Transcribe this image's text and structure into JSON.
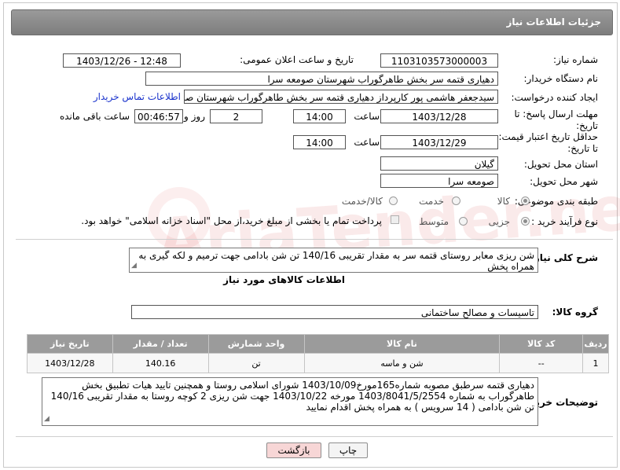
{
  "header": {
    "title": "جزئیات اطلاعات نیاز"
  },
  "fields": {
    "need_number_label": "شماره نیاز:",
    "need_number": "1103103573000003",
    "announce_label": "تاریخ و ساعت اعلان عمومی:",
    "announce_value": "1403/12/26 - 12:48",
    "buyer_org_label": "نام دستگاه خریدار:",
    "buyer_org": "دهیاری قتمه سر بخش طاهرگوراب شهرستان صومعه سرا",
    "creator_label": "ایجاد کننده درخواست:",
    "creator": "سیدجعفر هاشمی پور کارپرداز دهیاری قتمه سر بخش طاهرگوراب شهرستان صر",
    "contact_link": "اطلاعات تماس خریدار",
    "deadline_label": "مهلت ارسال پاسخ: تا تاریخ:",
    "deadline_date": "1403/12/28",
    "time_label": "ساعت",
    "deadline_time": "14:00",
    "days_value": "2",
    "days_label": "روز و",
    "remaining_time": "00:46:57",
    "remaining_label": "ساعت باقی مانده",
    "validity_label": "حداقل تاریخ اعتبار قیمت: تا تاریخ:",
    "validity_date": "1403/12/29",
    "validity_time": "14:00",
    "province_label": "استان محل تحویل:",
    "province": "گیلان",
    "city_label": "شهر محل تحویل:",
    "city": "صومعه سرا",
    "category_label": "طبقه بندی موضوعی:",
    "category_options": [
      "کالا",
      "خدمت",
      "کالا/خدمت"
    ],
    "purchase_label": "نوع فرآیند خرید :",
    "purchase_options": [
      "جزیی",
      "متوسط"
    ],
    "payment_note": "پرداخت تمام یا بخشی از مبلغ خرید،از محل \"اسناد خزانه اسلامی\" خواهد بود.",
    "summary_label": "شرح کلی نیاز:",
    "summary": "شن ریزی معابر روستای قتمه سر به مقدار تقریبی 140/16 تن شن بادامی جهت ترمیم و لکه گیری به همراه پخش",
    "goods_info_title": "اطلاعات کالاهای مورد نیاز",
    "goods_group_label": "گروه کالا:",
    "goods_group": "تاسیسات و مصالح ساختمانی"
  },
  "table": {
    "headers": [
      "ردیف",
      "کد کالا",
      "نام کالا",
      "واحد شمارش",
      "تعداد / مقدار",
      "تاریخ نیاز"
    ],
    "rows": [
      [
        "1",
        "--",
        "شن و ماسه",
        "تن",
        "140.16",
        "1403/12/28"
      ]
    ]
  },
  "buyer_notes": {
    "label": "توضیحات خریدار:",
    "text": "دهیاری قتمه سرطبق مصوبه شماره165مورخ1403/10/09 شورای اسلامی روستا و همچنین تایید هیات تطبیق بخش طاهرگوراب به شماره 1403/8041/5/2554 مورخه 1403/10/22 جهت شن ریزی 2 کوچه روستا به مقدار تقریبی 140/16 تن شن بادامی ( 14 سرویس ) به همراه پخش اقدام نمایید"
  },
  "buttons": {
    "print": "چاپ",
    "back": "بازگشت"
  },
  "colors": {
    "header_bg": "#8a8a8a",
    "link": "#1a33cc",
    "back_button_bg": "#f7d6d6"
  }
}
